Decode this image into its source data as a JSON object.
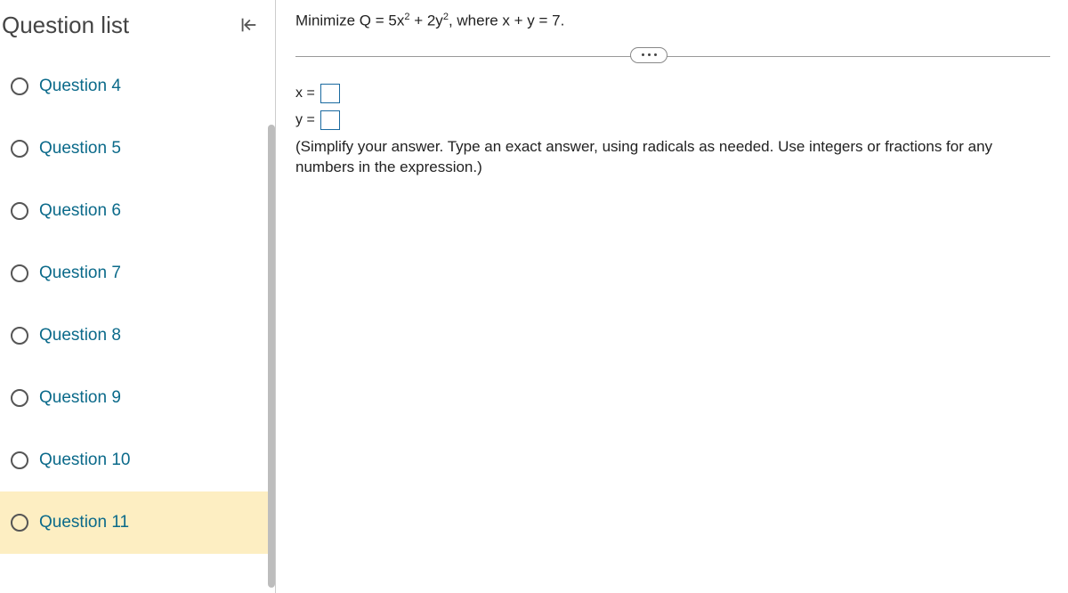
{
  "sidebar": {
    "title": "Question list",
    "items": [
      {
        "label": "Question 4",
        "active": false
      },
      {
        "label": "Question 5",
        "active": false
      },
      {
        "label": "Question 6",
        "active": false
      },
      {
        "label": "Question 7",
        "active": false
      },
      {
        "label": "Question 8",
        "active": false
      },
      {
        "label": "Question 9",
        "active": false
      },
      {
        "label": "Question 10",
        "active": false
      },
      {
        "label": "Question 11",
        "active": true
      }
    ]
  },
  "main": {
    "prompt_prefix": "Minimize Q = 5x",
    "prompt_mid1": " + 2y",
    "prompt_suffix": ", where x + y = 7.",
    "exp": "2",
    "x_label": "x =",
    "y_label": "y =",
    "x_value": "",
    "y_value": "",
    "instructions": "(Simplify your answer. Type an exact answer, using radicals as needed. Use integers or fractions for any numbers in the expression.)"
  }
}
